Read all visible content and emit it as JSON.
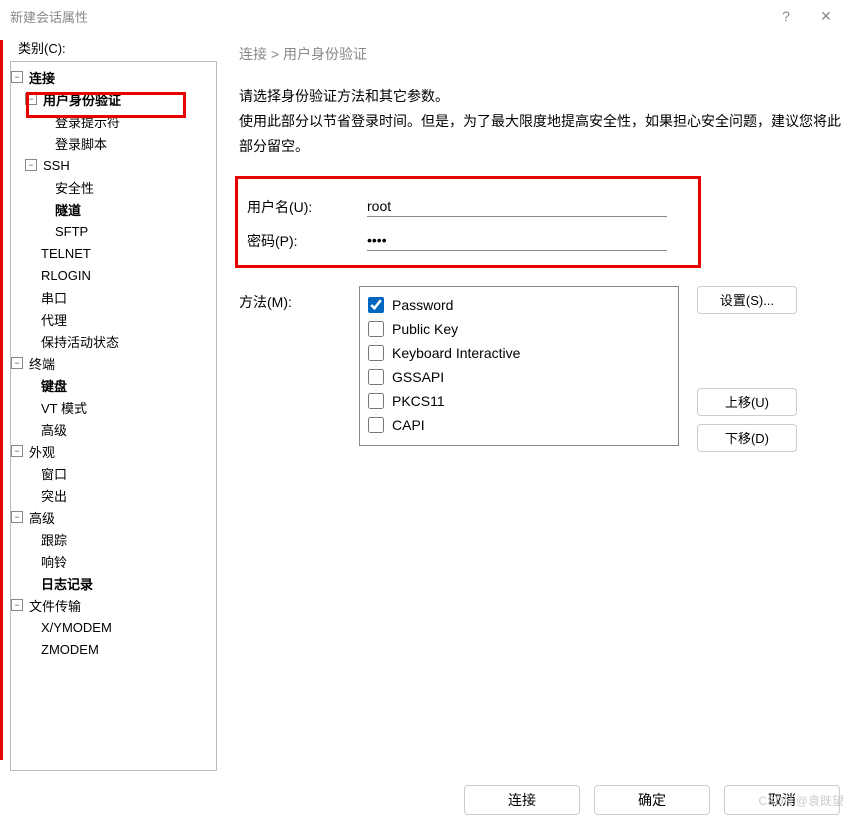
{
  "window": {
    "title": "新建会话属性"
  },
  "sidebar": {
    "label": "类别(C):",
    "tree": [
      {
        "label": "连接",
        "bold": true,
        "children": [
          {
            "label": "用户身份验证",
            "bold": true,
            "children": [
              {
                "label": "登录提示符"
              },
              {
                "label": "登录脚本"
              }
            ]
          },
          {
            "label": "SSH",
            "children": [
              {
                "label": "安全性"
              },
              {
                "label": "隧道",
                "bold": true
              },
              {
                "label": "SFTP"
              }
            ]
          },
          {
            "label": "TELNET"
          },
          {
            "label": "RLOGIN"
          },
          {
            "label": "串口"
          },
          {
            "label": "代理"
          },
          {
            "label": "保持活动状态"
          }
        ]
      },
      {
        "label": "终端",
        "children": [
          {
            "label": "键盘",
            "bold": true
          },
          {
            "label": "VT 模式"
          },
          {
            "label": "高级"
          }
        ]
      },
      {
        "label": "外观",
        "children": [
          {
            "label": "窗口"
          },
          {
            "label": "突出"
          }
        ]
      },
      {
        "label": "高级",
        "children": [
          {
            "label": "跟踪"
          },
          {
            "label": "响铃"
          },
          {
            "label": "日志记录",
            "bold": true
          }
        ]
      },
      {
        "label": "文件传输",
        "children": [
          {
            "label": "X/YMODEM"
          },
          {
            "label": "ZMODEM"
          }
        ]
      }
    ]
  },
  "breadcrumb": "连接 > 用户身份验证",
  "desc1": "请选择身份验证方法和其它参数。",
  "desc2": "使用此部分以节省登录时间。但是，为了最大限度地提高安全性，如果担心安全问题，建议您将此部分留空。",
  "form": {
    "username_label": "用户名(U):",
    "username_value": "root",
    "password_label": "密码(P):",
    "password_value": "••••",
    "method_label": "方法(M):",
    "methods": [
      {
        "label": "Password",
        "checked": true
      },
      {
        "label": "Public Key",
        "checked": false
      },
      {
        "label": "Keyboard Interactive",
        "checked": false
      },
      {
        "label": "GSSAPI",
        "checked": false
      },
      {
        "label": "PKCS11",
        "checked": false
      },
      {
        "label": "CAPI",
        "checked": false
      }
    ],
    "settings_btn": "设置(S)...",
    "up_btn": "上移(U)",
    "down_btn": "下移(D)"
  },
  "footer": {
    "connect": "连接",
    "ok": "确定",
    "cancel": "取消"
  },
  "watermark": "CSDN @袁既望"
}
